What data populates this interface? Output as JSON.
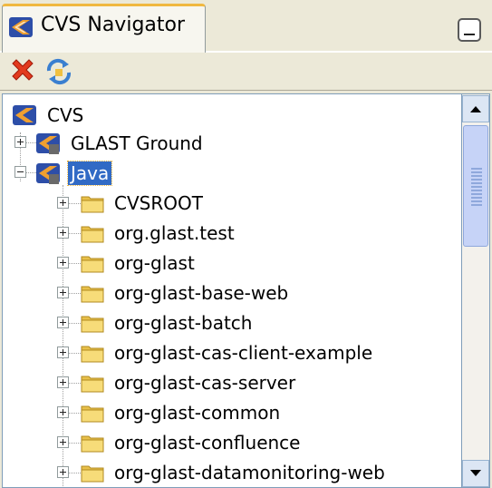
{
  "tab": {
    "title": "CVS Navigator"
  },
  "toolbar": {
    "remove_icon": "red-x-icon",
    "refresh_icon": "refresh-icon"
  },
  "tree": {
    "root": {
      "label": "CVS"
    },
    "projects": [
      {
        "label": "GLAST Ground",
        "expanded": false,
        "selected": false
      },
      {
        "label": "Java",
        "expanded": true,
        "selected": true
      }
    ],
    "folders": [
      {
        "label": "CVSROOT"
      },
      {
        "label": "org.glast.test"
      },
      {
        "label": "org-glast"
      },
      {
        "label": "org-glast-base-web"
      },
      {
        "label": "org-glast-batch"
      },
      {
        "label": "org-glast-cas-client-example"
      },
      {
        "label": "org-glast-cas-server"
      },
      {
        "label": "org-glast-common"
      },
      {
        "label": "org-glast-confluence"
      },
      {
        "label": "org-glast-datamonitoring-web"
      }
    ]
  },
  "colors": {
    "selection": "#316ac5",
    "folder": "#f4d46a",
    "background": "#ece9d8"
  }
}
